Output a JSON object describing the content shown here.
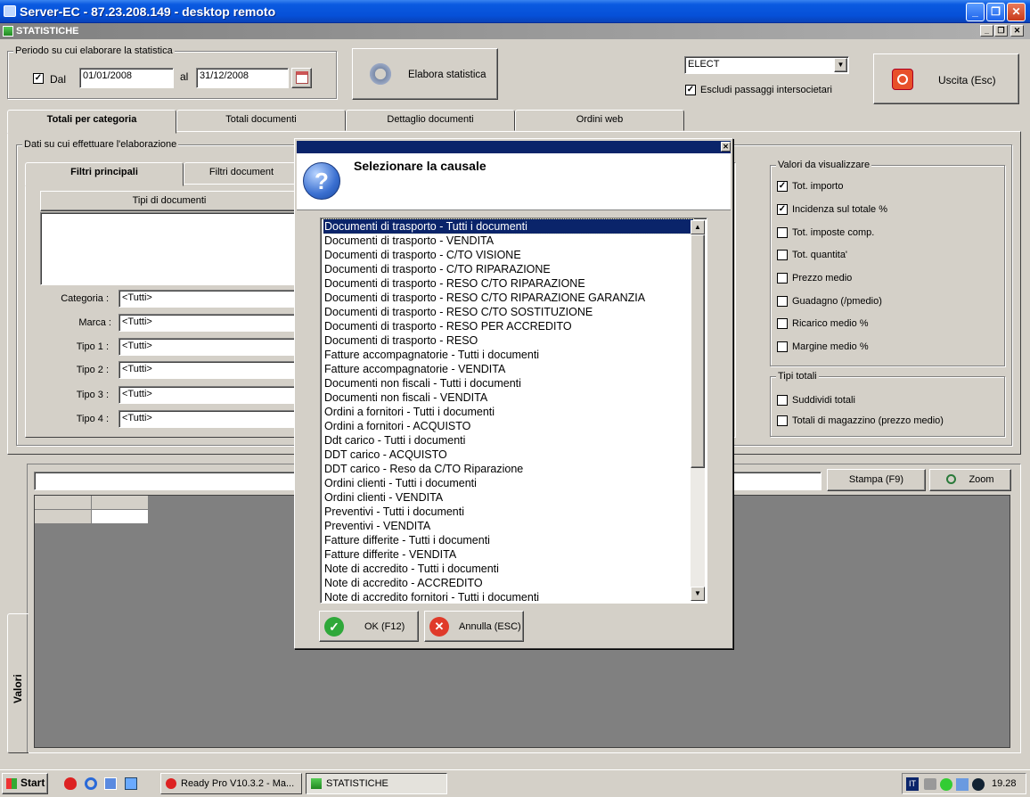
{
  "window": {
    "title": "Server-EC - 87.23.208.149 - desktop remoto"
  },
  "mdi": {
    "title": "STATISTICHE"
  },
  "period": {
    "legend": "Periodo su cui elaborare la statistica",
    "dal_label": "Dal",
    "from": "01/01/2008",
    "al_label": "al",
    "to": "31/12/2008"
  },
  "toolbar": {
    "elabora_label": "Elabora statistica",
    "company_select": "ELECT",
    "escludi_label": "Escludi passaggi intersocietari",
    "uscita_label": "Uscita (Esc)"
  },
  "tabs": [
    {
      "label": "Totali per categoria"
    },
    {
      "label": "Totali documenti"
    },
    {
      "label": "Dettaglio documenti"
    },
    {
      "label": "Ordini web"
    }
  ],
  "data_group": {
    "legend": "Dati su cui effettuare l'elaborazione"
  },
  "subtabs": [
    {
      "label": "Filtri principali"
    },
    {
      "label": "Filtri document"
    }
  ],
  "doc_types": {
    "header": "Tipi di documenti"
  },
  "filters": [
    {
      "label": "Categoria :",
      "value": "<Tutti>"
    },
    {
      "label": "Marca :",
      "value": "<Tutti>"
    },
    {
      "label": "Tipo 1 :",
      "value": "<Tutti>"
    },
    {
      "label": "Tipo 2 :",
      "value": "<Tutti>"
    },
    {
      "label": "Tipo 3 :",
      "value": "<Tutti>"
    },
    {
      "label": "Tipo 4 :",
      "value": "<Tutti>"
    }
  ],
  "valori": {
    "legend": "Valori da visualizzare",
    "items": [
      {
        "label": "Tot. importo",
        "checked": "✓"
      },
      {
        "label": "Incidenza sul totale %",
        "checked": "✓"
      },
      {
        "label": "Tot. imposte comp.",
        "checked": ""
      },
      {
        "label": "Tot. quantita'",
        "checked": ""
      },
      {
        "label": "Prezzo medio",
        "checked": ""
      },
      {
        "label": "Guadagno (/pmedio)",
        "checked": ""
      },
      {
        "label": "Ricarico medio %",
        "checked": ""
      },
      {
        "label": "Margine medio %",
        "checked": ""
      }
    ]
  },
  "tipi_totali": {
    "legend": "Tipi totali",
    "items": [
      {
        "label": "Suddividi totali",
        "checked": ""
      },
      {
        "label": "Totali di magazzino (prezzo medio)",
        "checked": ""
      }
    ]
  },
  "results": {
    "stampa_label": "Stampa (F9)",
    "zoom_label": "Zoom",
    "side_tab": "Valori"
  },
  "dialog": {
    "title": "Selezionare la causale",
    "ok_label": "OK (F12)",
    "cancel_label": "Annulla (ESC)",
    "items": [
      "Documenti di trasporto - Tutti i documenti",
      "Documenti di trasporto - VENDITA",
      "Documenti di trasporto - C/TO VISIONE",
      "Documenti di trasporto - C/TO RIPARAZIONE",
      "Documenti di trasporto - RESO C/TO RIPARAZIONE",
      "Documenti di trasporto - RESO C/TO RIPARAZIONE GARANZIA",
      "Documenti di trasporto - RESO C/TO SOSTITUZIONE",
      "Documenti di trasporto - RESO PER ACCREDITO",
      "Documenti di trasporto - RESO",
      "Fatture accompagnatorie - Tutti i documenti",
      "Fatture accompagnatorie - VENDITA",
      "Documenti non fiscali - Tutti i documenti",
      "Documenti non fiscali - VENDITA",
      "Ordini a fornitori - Tutti i documenti",
      "Ordini a fornitori - ACQUISTO",
      "Ddt carico - Tutti i documenti",
      "DDT carico - ACQUISTO",
      "DDT carico - Reso da C/TO Riparazione",
      "Ordini clienti - Tutti i documenti",
      "Ordini clienti - VENDITA",
      "Preventivi - Tutti i documenti",
      "Preventivi - VENDITA",
      "Fatture differite - Tutti i documenti",
      "Fatture differite - VENDITA",
      "Note di accredito - Tutti i documenti",
      "Note di accredito - ACCREDITO",
      "Note di accredito fornitori - Tutti i documenti"
    ]
  },
  "taskbar": {
    "start": "Start",
    "tasks": [
      "Ready Pro V10.3.2 - Ma...",
      "STATISTICHE"
    ],
    "lang": "IT",
    "clock": "19.28"
  }
}
